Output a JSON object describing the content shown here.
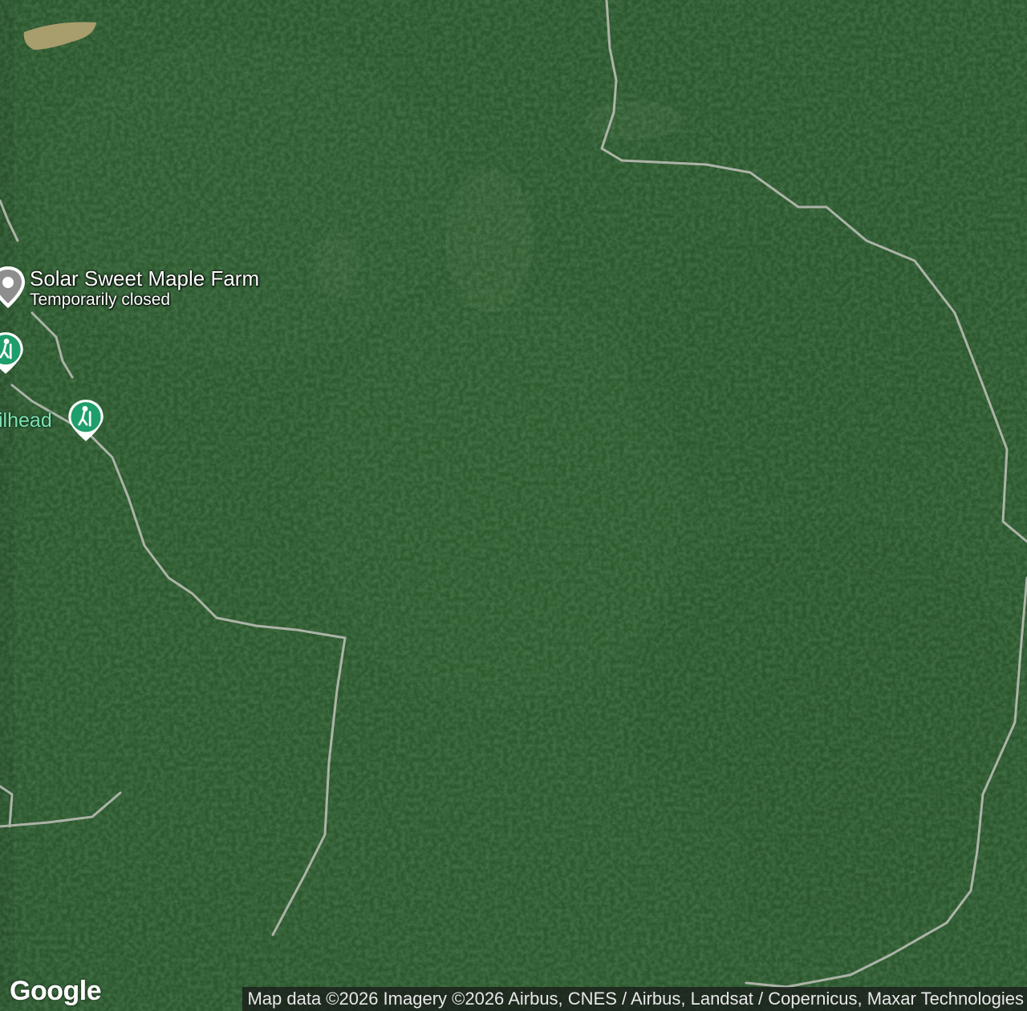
{
  "map": {
    "type": "satellite"
  },
  "places": [
    {
      "name": "Solar Sweet Maple Farm",
      "status": "Temporarily closed",
      "icon": "gray-place-pin-icon"
    }
  ],
  "trailheads": [
    {
      "label": "ilhead",
      "icon": "hiking-trailhead-icon"
    },
    {
      "label": "",
      "icon": "hiking-trailhead-icon"
    }
  ],
  "branding": {
    "logo": "Google"
  },
  "attribution": "Map data ©2026 Imagery ©2026 Airbus, CNES / Airbus, Landsat / Copernicus, Maxar Technologies",
  "colors": {
    "forest": "#2e5a30",
    "road": "#b9bcb4",
    "trail_marker": "#1e9e6a",
    "place_pin": "#8e8e8e"
  }
}
